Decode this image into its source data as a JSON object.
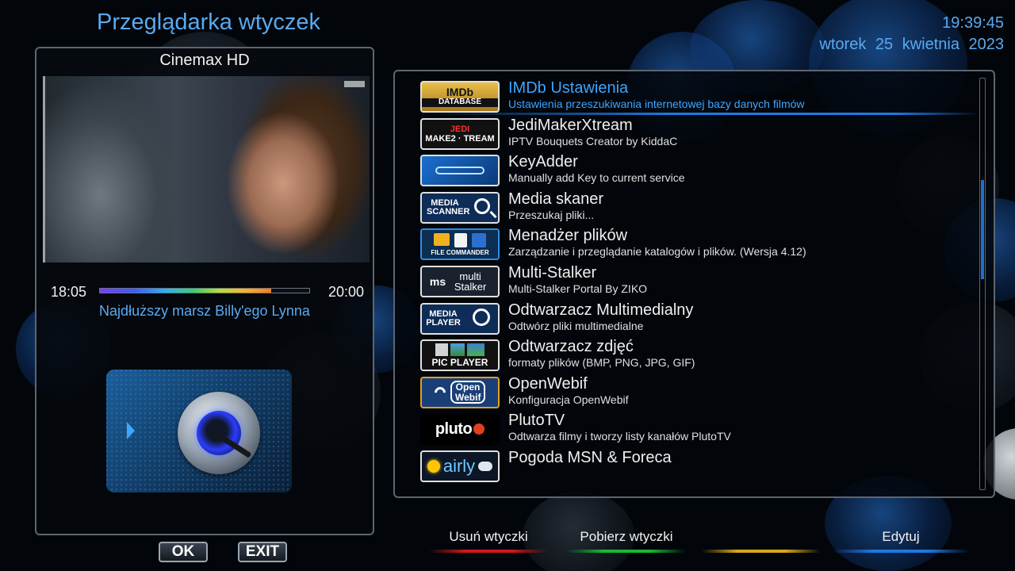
{
  "header": {
    "title": "Przeglądarka wtyczek",
    "clock": "19:39:45",
    "date": "wtorek  25  kwietnia  2023"
  },
  "preview": {
    "channel": "Cinemax HD",
    "time_start": "18:05",
    "time_end": "20:00",
    "progress": 0.82,
    "program": "Najdłuższy marsz Billy'ego Lynna"
  },
  "plugins": [
    {
      "name": "IMDb Ustawienia",
      "description": "Ustawienia przeszukiwania internetowej bazy danych filmów",
      "icon": "imdb-database-icon",
      "icon_text": "IMDb",
      "icon_sub": "DATABASE"
    },
    {
      "name": "JediMakerXtream",
      "description": "IPTV Bouquets Creator by KiddaC",
      "icon": "jedimaker-xtream-icon",
      "icon_text": "JEDI",
      "icon_sub": "MAKE2 · TREAM"
    },
    {
      "name": "KeyAdder",
      "description": "Manually add Key to current service",
      "icon": "key-icon"
    },
    {
      "name": "Media skaner",
      "description": "Przeszukaj pliki...",
      "icon": "media-scanner-icon",
      "icon_text": "MEDIA SCANNER"
    },
    {
      "name": "Menadżer plików",
      "description": "Zarządzanie i przeglądanie katalogów i plików. (Wersja 4.12)",
      "icon": "file-commander-icon",
      "icon_text": "FILE COMMANDER"
    },
    {
      "name": "Multi-Stalker",
      "description": "Multi-Stalker Portal By ZIKO",
      "icon": "multi-stalker-icon",
      "icon_text": "ms",
      "icon_sub": "multi Stalker"
    },
    {
      "name": "Odtwarzacz Multimedialny",
      "description": "Odtwórz pliki multimedialne",
      "icon": "media-player-icon",
      "icon_text": "MEDIA PLAYER"
    },
    {
      "name": "Odtwarzacz zdjęć",
      "description": "formaty plików (BMP, PNG, JPG, GIF)",
      "icon": "pic-player-icon",
      "icon_text": "PIC PLAYER"
    },
    {
      "name": "OpenWebif",
      "description": "Konfiguracja OpenWebif",
      "icon": "openwebif-icon",
      "icon_text": "Open Webif"
    },
    {
      "name": "PlutoTV",
      "description": "Odtwarza filmy i tworzy listy kanałów PlutoTV",
      "icon": "pluto-tv-icon",
      "icon_text": "pluto"
    },
    {
      "name": "Pogoda MSN & Foreca",
      "description": "",
      "icon": "airly-weather-icon",
      "icon_text": "airly"
    }
  ],
  "buttons": {
    "ok": "OK",
    "exit": "EXIT"
  },
  "color_keys": {
    "red": "Usuń wtyczki",
    "green": "Pobierz wtyczki",
    "yellow": "",
    "blue": "Edytuj"
  },
  "colors": {
    "accent": "#3ea6ff",
    "title": "#5aa9f0",
    "red": "#d01818",
    "green": "#18b830",
    "yellow": "#d8a818",
    "blue": "#1e78e0"
  }
}
